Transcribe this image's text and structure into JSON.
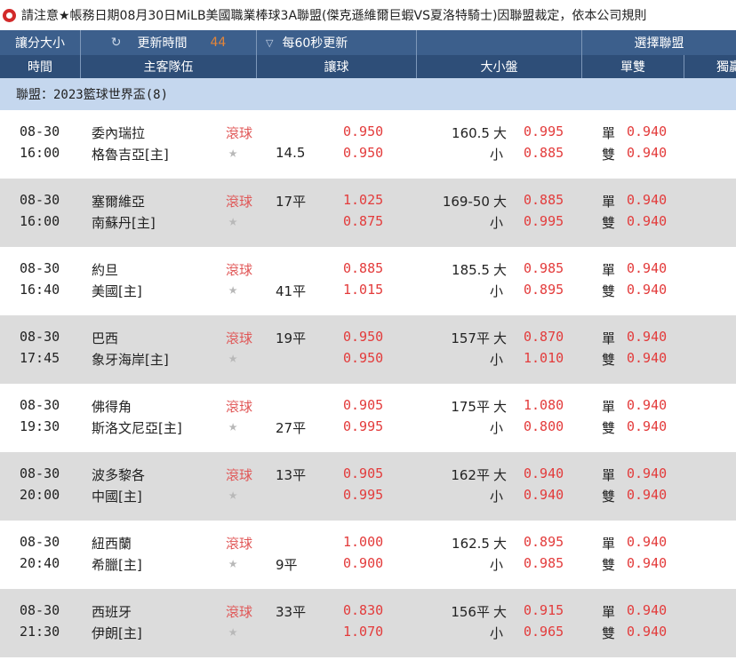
{
  "notice": {
    "text": "請注意★帳務日期08月30日MiLB美國職業棒球3A聯盟(傑克遜維爾巨蝦VS夏洛特騎士)因聯盟裁定，依本公司規則"
  },
  "toolbar": {
    "handicap_size_label": "讓分大小",
    "update_time_label": "更新時間",
    "countdown": "44",
    "interval_label": "每60秒更新",
    "league_select_label": "選擇聯盟"
  },
  "columns": [
    "時間",
    "主客隊伍",
    "讓球",
    "大小盤",
    "單雙",
    "獨贏"
  ],
  "league": {
    "label": "聯盟：",
    "name": "2023籃球世界盃(8)"
  },
  "matches": [
    {
      "date": "08-30",
      "time": "16:00",
      "team1": "委內瑞拉",
      "team2": "格魯吉亞[主]",
      "status": "滾球",
      "hcp1": "",
      "hcp2": "14.5",
      "hodds1": "0.950",
      "hodds2": "0.950",
      "total": "160.5",
      "over_label": "大",
      "under_label": "小",
      "oodds1": "0.995",
      "oodds2": "0.885",
      "odd_label": "單",
      "even_label": "雙",
      "odd_odds": "0.940",
      "even_odds": "0.940"
    },
    {
      "date": "08-30",
      "time": "16:00",
      "team1": "塞爾維亞",
      "team2": "南蘇丹[主]",
      "status": "滾球",
      "hcp1": "17平",
      "hcp2": "",
      "hodds1": "1.025",
      "hodds2": "0.875",
      "total": "169-50",
      "over_label": "大",
      "under_label": "小",
      "oodds1": "0.885",
      "oodds2": "0.995",
      "odd_label": "單",
      "even_label": "雙",
      "odd_odds": "0.940",
      "even_odds": "0.940"
    },
    {
      "date": "08-30",
      "time": "16:40",
      "team1": "約旦",
      "team2": "美國[主]",
      "status": "滾球",
      "hcp1": "",
      "hcp2": "41平",
      "hodds1": "0.885",
      "hodds2": "1.015",
      "total": "185.5",
      "over_label": "大",
      "under_label": "小",
      "oodds1": "0.985",
      "oodds2": "0.895",
      "odd_label": "單",
      "even_label": "雙",
      "odd_odds": "0.940",
      "even_odds": "0.940"
    },
    {
      "date": "08-30",
      "time": "17:45",
      "team1": "巴西",
      "team2": "象牙海岸[主]",
      "status": "滾球",
      "hcp1": "19平",
      "hcp2": "",
      "hodds1": "0.950",
      "hodds2": "0.950",
      "total": "157平",
      "over_label": "大",
      "under_label": "小",
      "oodds1": "0.870",
      "oodds2": "1.010",
      "odd_label": "單",
      "even_label": "雙",
      "odd_odds": "0.940",
      "even_odds": "0.940"
    },
    {
      "date": "08-30",
      "time": "19:30",
      "team1": "佛得角",
      "team2": "斯洛文尼亞[主]",
      "status": "滾球",
      "hcp1": "",
      "hcp2": "27平",
      "hodds1": "0.905",
      "hodds2": "0.995",
      "total": "175平",
      "over_label": "大",
      "under_label": "小",
      "oodds1": "1.080",
      "oodds2": "0.800",
      "odd_label": "單",
      "even_label": "雙",
      "odd_odds": "0.940",
      "even_odds": "0.940"
    },
    {
      "date": "08-30",
      "time": "20:00",
      "team1": "波多黎各",
      "team2": "中國[主]",
      "status": "滾球",
      "hcp1": "13平",
      "hcp2": "",
      "hodds1": "0.905",
      "hodds2": "0.995",
      "total": "162平",
      "over_label": "大",
      "under_label": "小",
      "oodds1": "0.940",
      "oodds2": "0.940",
      "odd_label": "單",
      "even_label": "雙",
      "odd_odds": "0.940",
      "even_odds": "0.940"
    },
    {
      "date": "08-30",
      "time": "20:40",
      "team1": "紐西蘭",
      "team2": "希臘[主]",
      "status": "滾球",
      "hcp1": "",
      "hcp2": "9平",
      "hodds1": "1.000",
      "hodds2": "0.900",
      "total": "162.5",
      "over_label": "大",
      "under_label": "小",
      "oodds1": "0.895",
      "oodds2": "0.985",
      "odd_label": "單",
      "even_label": "雙",
      "odd_odds": "0.940",
      "even_odds": "0.940"
    },
    {
      "date": "08-30",
      "time": "21:30",
      "team1": "西班牙",
      "team2": "伊朗[主]",
      "status": "滾球",
      "hcp1": "33平",
      "hcp2": "",
      "hodds1": "0.830",
      "hodds2": "1.070",
      "total": "156平",
      "over_label": "大",
      "under_label": "小",
      "oodds1": "0.915",
      "oodds2": "0.965",
      "odd_label": "單",
      "even_label": "雙",
      "odd_odds": "0.940",
      "even_odds": "0.940"
    }
  ]
}
